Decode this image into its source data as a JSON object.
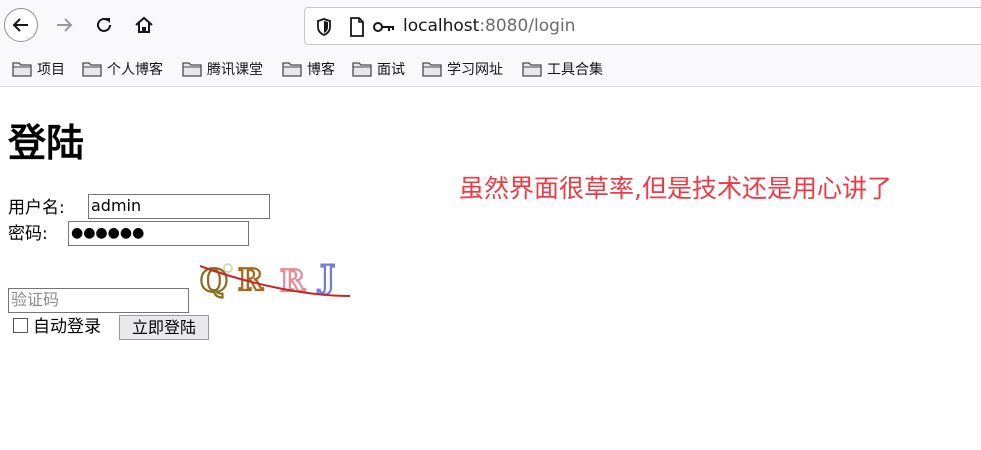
{
  "browser": {
    "url_host": "localhost",
    "url_rest": ":8080/login",
    "bookmarks": [
      "项目",
      "个人博客",
      "腾讯课堂",
      "博客",
      "面试",
      "学习网址",
      "工具合集"
    ]
  },
  "page": {
    "title": "登陆",
    "username_label": "用户名:",
    "username_value": "admin",
    "password_label": "密码:",
    "password_mask": "●●●●●●",
    "captcha_placeholder": "验证码",
    "captcha_text": "QRRJ",
    "remember_label": "自动登录",
    "submit_label": "立即登陆",
    "note": "虽然界面很草率,但是技术还是用心讲了"
  },
  "colors": {
    "note": "#ed3b45",
    "captcha_q": "#8b6d1e",
    "captcha_r1": "#a8681e",
    "captcha_r2": "#e88a9a",
    "captcha_j": "#6f7be0",
    "captcha_line": "#c42a2a"
  }
}
